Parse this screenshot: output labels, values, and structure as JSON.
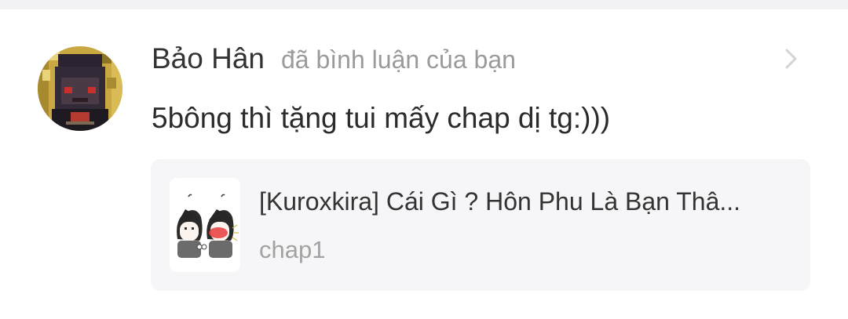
{
  "notification": {
    "user_name": "Bảo Hân",
    "action": "đã bình luận của bạn",
    "comment": "5bông thì tặng tui mấy chap dị tg:)))",
    "avatar_icon": "user-avatar-icon",
    "chevron_icon": "chevron-right-icon"
  },
  "story": {
    "title": "[Kuroxkira] Cái Gì ? Hôn Phu Là Bạn Thâ...",
    "chapter": "chap1",
    "cover_icon": "story-cover-image"
  },
  "colors": {
    "name": "#333333",
    "action": "#9a9a9a",
    "card_background": "#f6f6f8",
    "chevron": "#d4d4d4"
  }
}
